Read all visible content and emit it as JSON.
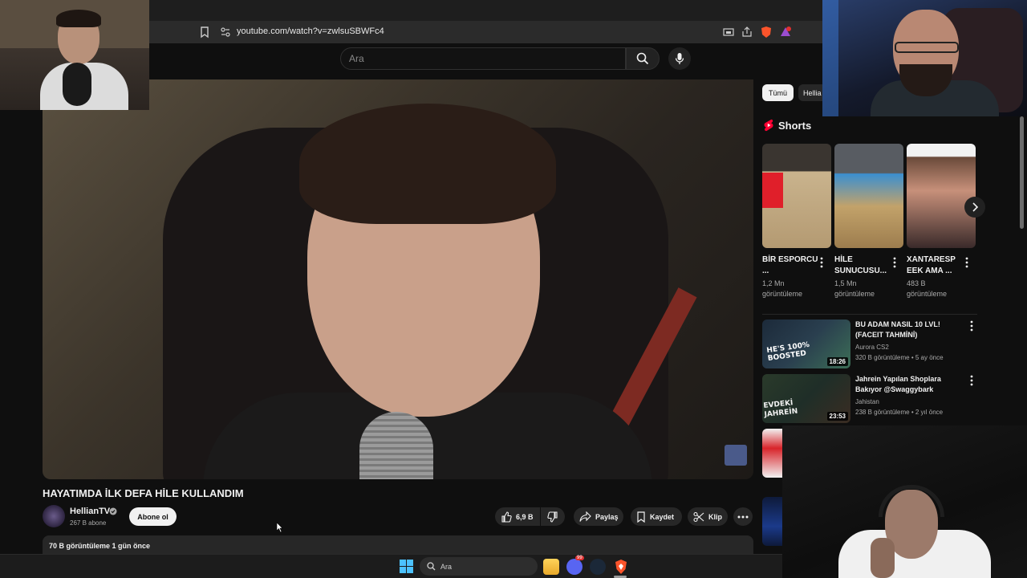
{
  "browser": {
    "url": "youtube.com/watch?v=zwlsuSBWFc4"
  },
  "header": {
    "search_placeholder": "Ara"
  },
  "video": {
    "title": "HAYATIMDA İLK DEFA HİLE KULLANDIM",
    "channel_name": "HellianTV",
    "subscribers": "267 B abone",
    "subscribe_label": "Abone ol",
    "likes": "6,9 B",
    "share_label": "Paylaş",
    "save_label": "Kaydet",
    "clip_label": "Klip",
    "views_date": "70 B görüntüleme  1 gün önce"
  },
  "sidebar": {
    "chips": [
      "Tümü",
      "Hellia"
    ],
    "shorts_heading": "Shorts",
    "shorts": [
      {
        "title": "BİR ESPORCU ...",
        "views": "1,2 Mn görüntüleme"
      },
      {
        "title": "HİLE SUNUCUSU...",
        "views": "1,5 Mn görüntüleme"
      },
      {
        "title": "XANTARESP EEK AMA ...",
        "views": "483 B görüntüleme"
      }
    ],
    "recommended": [
      {
        "title": "BU ADAM NASIL 10 LVL! (FACEIT TAHMİNİ)",
        "channel": "Aurora CS2",
        "meta": "320 B görüntüleme • 5 ay önce",
        "duration": "18:26",
        "thumb_text": "HE'S 100% BOOSTED"
      },
      {
        "title": "Jahrein Yapılan Shoplara Bakıyor @Swaggybark",
        "channel": "Jahistan",
        "meta": "238 B görüntüleme • 2 yıl önce",
        "duration": "23:53",
        "thumb_text": "EVDEKİ JAHREİN"
      }
    ]
  },
  "taskbar": {
    "search_placeholder": "Ara",
    "discord_badge": "99"
  },
  "colors": {
    "background": "#0f0f0f",
    "youtube_red": "#ff0033",
    "pill": "#272727",
    "text_secondary": "#aaaaaa"
  }
}
